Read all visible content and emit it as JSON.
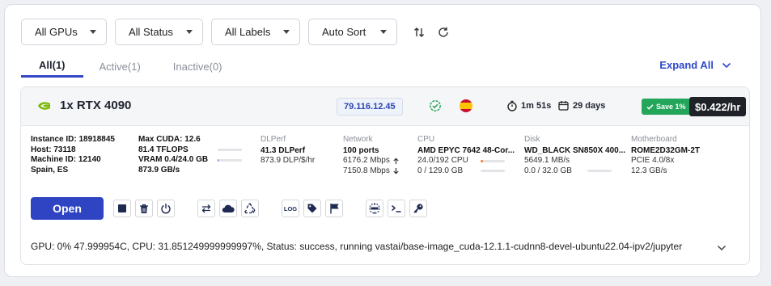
{
  "filters": {
    "gpus": "All GPUs",
    "status": "All Status",
    "labels": "All Labels",
    "sort": "Auto Sort"
  },
  "tabs": [
    {
      "label": "All(1)",
      "active": true
    },
    {
      "label": "Active(1)",
      "active": false
    },
    {
      "label": "Inactive(0)",
      "active": false
    }
  ],
  "expand_all": "Expand All",
  "instance": {
    "gpu": "1x RTX 4090",
    "ip": "79.116.12.45",
    "uptime": "1m 51s",
    "duration": "29 days",
    "save_badge": "Save 1%",
    "price": "$0.422/hr",
    "info": {
      "instance_id": "Instance ID: 18918845",
      "host": "Host: 73118",
      "machine_id": "Machine ID: 12140",
      "location": "Spain, ES"
    },
    "cuda": {
      "max_cuda": "Max CUDA: 12.6",
      "tflops": "81.4 TFLOPS",
      "vram": "VRAM 0.4/24.0 GB",
      "bandwidth": "873.9 GB/s",
      "vram_usage": 0.02
    },
    "dlperf": {
      "label": "DLPerf",
      "value": "41.3 DLPerf",
      "per_dollar": "873.9 DLP/$/hr"
    },
    "network": {
      "label": "Network",
      "ports": "100 ports",
      "up": "6176.2 Mbps",
      "down": "7150.8 Mbps"
    },
    "cpu": {
      "label": "CPU",
      "model": "AMD EPYC 7642 48-Cor...",
      "cores": "24.0/192 CPU",
      "ram": "0 / 129.0 GB",
      "cpu_usage": 0.1
    },
    "disk": {
      "label": "Disk",
      "model": "WD_BLACK SN850X 400...",
      "speed": "5649.1 MB/s",
      "usage": "0.0 / 32.0 GB",
      "disk_usage": 0.0
    },
    "motherboard": {
      "label": "Motherboard",
      "model": "ROME2D32GM-2T",
      "pcie": "PCIE 4.0/8x",
      "bandwidth": "12.3 GB/s"
    },
    "open_label": "Open",
    "log_label": "LOG",
    "status_line": "GPU: 0% 47.999954C, CPU: 31.851249999999997%, Status: success, running vastai/base-image_cuda-12.1.1-cudnn8-devel-ubuntu22.04-ipv2/jupyter"
  },
  "colors": {
    "accent": "#2e44c2",
    "nvidia_green": "#76b900",
    "save_green": "#23a55a",
    "price_bg": "#1f2328"
  }
}
